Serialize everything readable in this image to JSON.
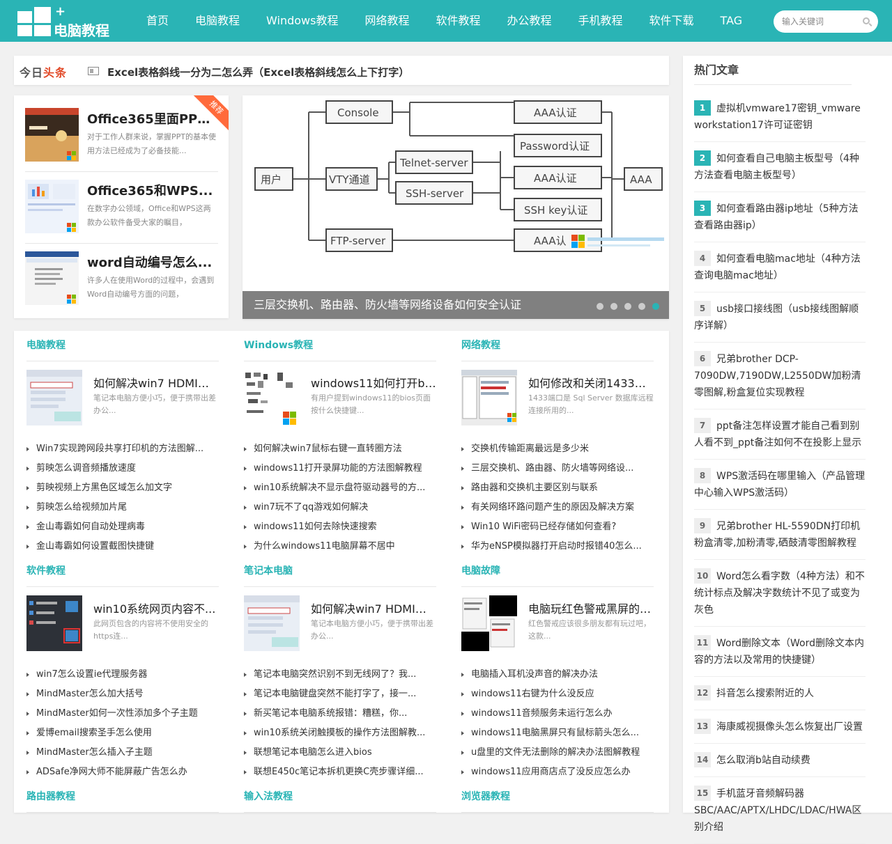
{
  "site": {
    "logo_text": "电脑教程",
    "logo_plus": "+"
  },
  "nav": [
    "首页",
    "电脑教程",
    "Windows教程",
    "网络教程",
    "软件教程",
    "办公教程",
    "手机教程",
    "软件下载",
    "TAG"
  ],
  "search": {
    "placeholder": "输入关键词"
  },
  "headline": {
    "brand_a": "今日",
    "brand_b": "头条",
    "title": "Excel表格斜线一分为二怎么弄（Excel表格斜线怎么上下打字）"
  },
  "featured": {
    "badge": "推荐",
    "items": [
      {
        "title": "Office365里面PPT...",
        "desc": "对于工作人群来说，掌握PPT的基本使用方法已经成为了必备技能..."
      },
      {
        "title": "Office365和WPS...",
        "desc": "在数字办公领域，Office和WPS这两款办公软件备受大家的瞩目，"
      },
      {
        "title": "word自动编号怎么...",
        "desc": "许多人在使用Word的过程中，会遇到Word自动编号方面的问题，"
      }
    ]
  },
  "slider": {
    "caption": "三层交换机、路由器、防火墙等网络设备如何安全认证",
    "diagram": {
      "user": "用户",
      "console": "Console",
      "vty": "VTY通道",
      "telnet": "Telnet-server",
      "ssh": "SSH-server",
      "ftp": "FTP-server",
      "aaa1": "AAA认证",
      "password": "Password认证",
      "aaa2": "AAA认证",
      "sshkey": "SSH key认证",
      "aaa3": "AAA认",
      "aaa": "AAA"
    },
    "dots": 5,
    "active_dot": 5
  },
  "categories": [
    {
      "name": "电脑教程",
      "top_title": "如何解决win7 HDMI输...",
      "top_desc": "笔记本电脑方便小巧，便于携带出差办公...",
      "items": [
        "Win7实现跨网段共享打印机的方法图解...",
        "剪映怎么调音频播放速度",
        "剪映视频上方黑色区域怎么加文字",
        "剪映怎么给视频加片尾",
        "金山毒霸如何自动处理病毒",
        "金山毒霸如何设置截图快捷键"
      ]
    },
    {
      "name": "Windows教程",
      "top_title": "windows11如何打开bi...",
      "top_desc": "有用户提到windows11的bios页面按什么快捷键...",
      "items": [
        "如何解决win7鼠标右键一直转圈方法",
        "windows11打开录屏功能的方法图解教程",
        "win10系统解决不显示盘符驱动器号的方...",
        "win7玩不了qq游戏如何解决",
        "windows11如何去除快速搜索",
        "为什么windows11电脑屏幕不居中"
      ]
    },
    {
      "name": "网络教程",
      "top_title": "如何修改和关闭1433端...",
      "top_desc": "1433端口是 Sql Server 数据库远程连接所用的...",
      "items": [
        "交换机传输距离最远是多少米",
        "三层交换机、路由器、防火墙等网络设...",
        "路由器和交换机主要区别与联系",
        "有关网络环路问题产生的原因及解决方案",
        "Win10 WiFi密码已经存储如何查看?",
        "华为eNSP模拟器打开启动时报错40怎么..."
      ]
    },
    {
      "name": "软件教程",
      "top_title": "win10系统网页内容不...",
      "top_desc": "此网页包含的内容将不使用安全的https连...",
      "items": [
        "win7怎么设置ie代理服务器",
        "MindMaster怎么加大括号",
        "MindMaster如何一次性添加多个子主题",
        "爱博email搜索圣手怎么使用",
        "MindMaster怎么插入子主题",
        "ADSafe净网大师不能屏蔽广告怎么办"
      ]
    },
    {
      "name": "笔记本电脑",
      "top_title": "如何解决win7 HDMI输...",
      "top_desc": "笔记本电脑方便小巧，便于携带出差办公...",
      "items": [
        "笔记本电脑突然识别不到无线网了？我...",
        "笔记本电脑键盘突然不能打字了，接一...",
        "新买笔记本电脑系统报错：糟糕，你...",
        "win10系统关闭触摸板的操作方法图解教...",
        "联想笔记本电脑怎么进入bios",
        "联想E450c笔记本拆机更换C壳步骤详细..."
      ]
    },
    {
      "name": "电脑故障",
      "top_title": "电脑玩红色警戒黑屏的解...",
      "top_desc": "红色警戒应该很多朋友都有玩过吧，这款...",
      "items": [
        "电脑插入耳机没声音的解决办法",
        "windows11右键为什么没反应",
        "windows11音频服务未运行怎么办",
        "windows11电脑黑屏只有鼠标箭头怎么...",
        "u盘里的文件无法删除的解决办法图解教程",
        "windows11应用商店点了没反应怎么办"
      ]
    },
    {
      "name": "路由器教程"
    },
    {
      "name": "输入法教程"
    },
    {
      "name": "浏览器教程"
    }
  ],
  "sidebar": {
    "title": "热门文章",
    "items": [
      {
        "num": "1",
        "text": "虚拟机vmware17密钥_vmware workstation17许可证密钥"
      },
      {
        "num": "2",
        "text": "如何查看自己电脑主板型号（4种方法查看电脑主板型号）"
      },
      {
        "num": "3",
        "text": "如何查看路由器ip地址（5种方法查看路由器ip）"
      },
      {
        "num": "4",
        "text": "如何查看电脑mac地址（4种方法查询电脑mac地址）"
      },
      {
        "num": "5",
        "text": "usb接口接线图（usb接线图解顺序详解）"
      },
      {
        "num": "6",
        "text": "兄弟brother DCP-7090DW,7190DW,L2550DW加粉清零图解,粉盒复位实现教程"
      },
      {
        "num": "7",
        "text": "ppt备注怎样设置才能自己看到别人看不到_ppt备注如何不在投影上显示"
      },
      {
        "num": "8",
        "text": "WPS激活码在哪里输入（产品管理中心输入WPS激活码）"
      },
      {
        "num": "9",
        "text": "兄弟brother HL-5590DN打印机粉盒清零,加粉清零,硒鼓清零图解教程"
      },
      {
        "num": "10",
        "text": "Word怎么看字数（4种方法）和不统计标点及解决字数统计不见了或变为灰色"
      },
      {
        "num": "11",
        "text": "Word删除文本（Word删除文本内容的方法以及常用的快捷键）"
      },
      {
        "num": "12",
        "text": "抖音怎么搜索附近的人"
      },
      {
        "num": "13",
        "text": "海康威视摄像头怎么恢复出厂设置"
      },
      {
        "num": "14",
        "text": "怎么取消b站自动续费"
      },
      {
        "num": "15",
        "text": "手机蓝牙音频解码器SBC/AAC/APTX/LHDC/LDAC/HWA区别介绍"
      }
    ]
  },
  "colors": {
    "accent": "#2ab4b5",
    "badge": "#ff6a3b"
  }
}
